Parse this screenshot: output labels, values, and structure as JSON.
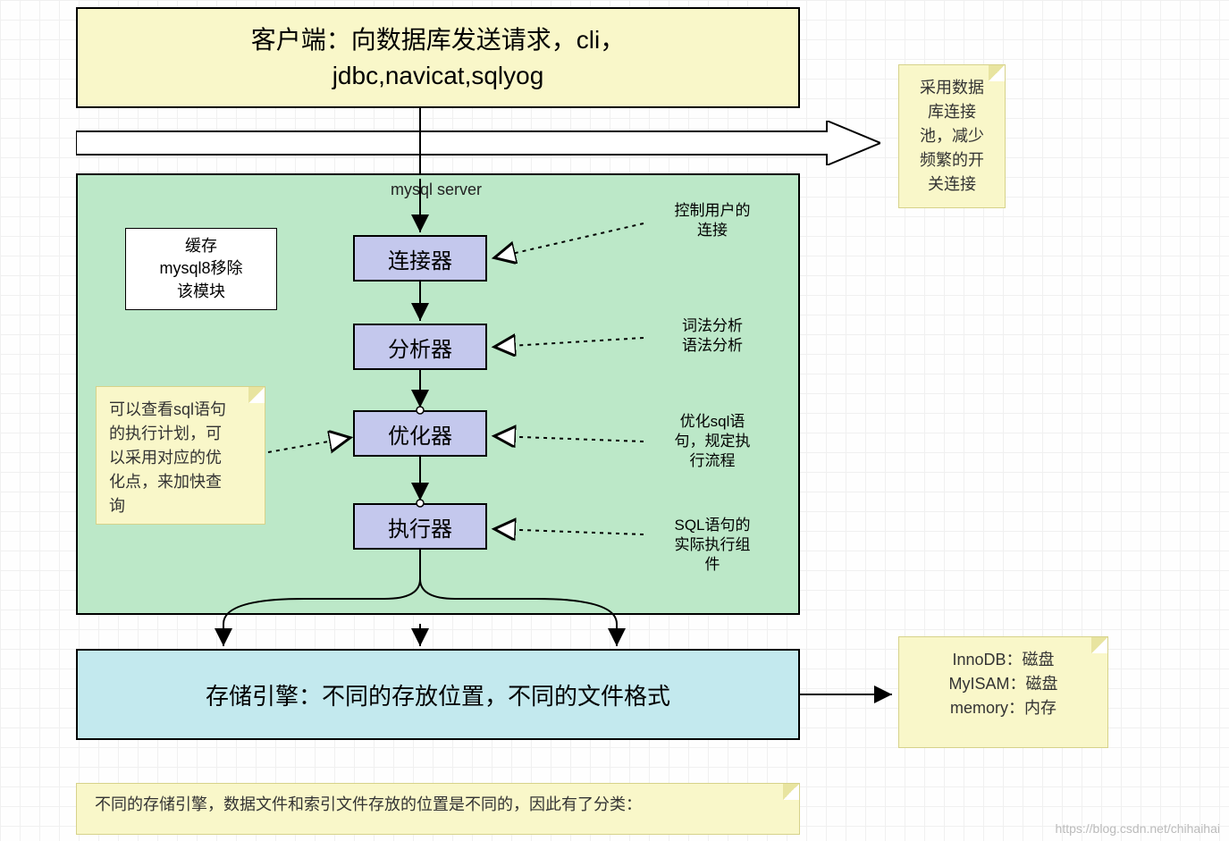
{
  "client": {
    "line1": "客户端：向数据库发送请求，cli，",
    "line2": "jdbc,navicat,sqlyog"
  },
  "server_label": "mysql server",
  "cache_note": "缓存\nmysql8移除\n该模块",
  "stages": {
    "connector": "连接器",
    "analyzer": "分析器",
    "optimizer": "优化器",
    "executor": "执行器"
  },
  "clouds": {
    "conn": "控制用户的\n连接",
    "analy": "词法分析\n语法分析",
    "opt": "优化sql语\n句，规定执\n行流程",
    "exec": "SQL语句的\n实际执行组\n件"
  },
  "notes": {
    "pool": "采用数据\n库连接\n池，减少\n频繁的开\n关连接",
    "optimizer": "可以查看sql语句\n的执行计划，可\n以采用对应的优\n化点，来加快查\n询",
    "engines": "InnoDB：磁盘\nMyISAM：磁盘\nmemory：内存",
    "bottom": "不同的存储引擎，数据文件和索引文件存放的位置是不同的，因此有了分类："
  },
  "storage": "存储引擎：不同的存放位置，不同的文件格式",
  "watermark": "https://blog.csdn.net/chihaihai"
}
